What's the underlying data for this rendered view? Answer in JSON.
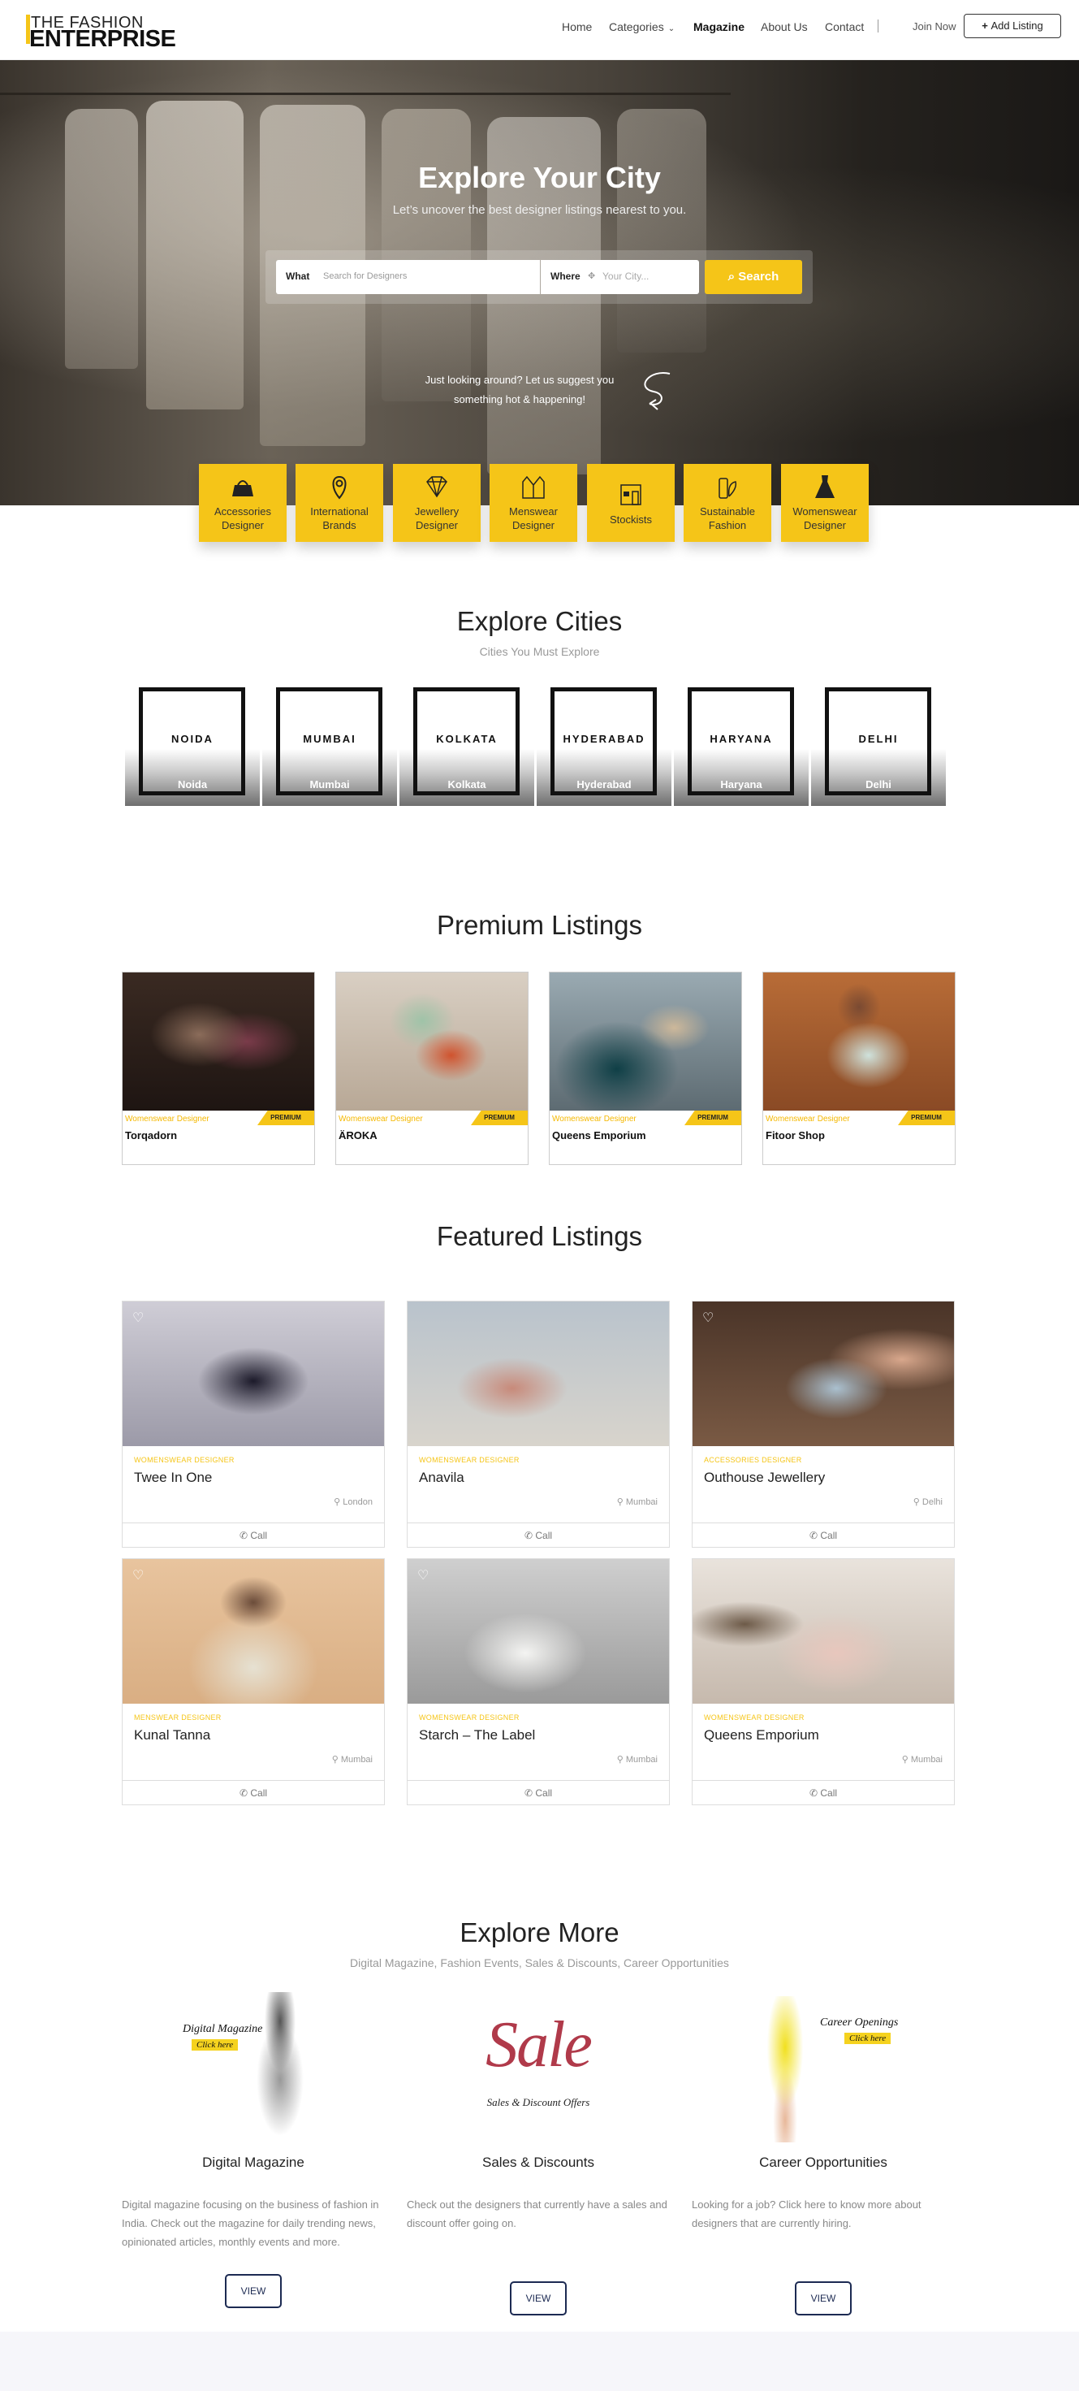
{
  "brand": {
    "line1": "THE FASHION",
    "line2": "ENTERPRISE"
  },
  "nav": {
    "items": [
      "Home",
      "Categories",
      "Magazine",
      "About Us",
      "Contact"
    ],
    "categories_chevron": "chevron-down-icon",
    "join_now": "Join Now",
    "add_listing": "Add Listing",
    "add_listing_icon": "plus-icon"
  },
  "hero": {
    "title": "Explore Your City",
    "subtitle": "Let’s uncover the best designer listings nearest to you.",
    "what_label": "What",
    "what_placeholder": "Search for Designers",
    "where_label": "Where",
    "where_placeholder": "Your City...",
    "search_button": "Search",
    "suggest_line1": "Just looking around? Let us suggest you",
    "suggest_line2": "something hot & happening!"
  },
  "categories": [
    {
      "label_1": "Accessories",
      "label_2": "Designer",
      "icon": "handbag-icon"
    },
    {
      "label_1": "International",
      "label_2": "Brands",
      "icon": "map-pin-icon"
    },
    {
      "label_1": "Jewellery",
      "label_2": "Designer",
      "icon": "diamond-icon"
    },
    {
      "label_1": "Menswear",
      "label_2": "Designer",
      "icon": "jacket-icon"
    },
    {
      "label_1": "Stockists",
      "label_2": "",
      "icon": "store-icon"
    },
    {
      "label_1": "Sustainable",
      "label_2": "Fashion",
      "icon": "eco-bottle-icon"
    },
    {
      "label_1": "Womenswear",
      "label_2": "Designer",
      "icon": "dress-icon"
    }
  ],
  "cities_section": {
    "title": "Explore Cities",
    "subtitle": "Cities You Must Explore",
    "cities": [
      {
        "tile": "NOIDA",
        "caption": "Noida"
      },
      {
        "tile": "MUMBAI",
        "caption": "Mumbai"
      },
      {
        "tile": "KOLKATA",
        "caption": "Kolkata"
      },
      {
        "tile": "HYDERABAD",
        "caption": "Hyderabad"
      },
      {
        "tile": "HARYANA",
        "caption": "Haryana"
      },
      {
        "tile": "DELHI",
        "caption": "Delhi"
      }
    ]
  },
  "premium": {
    "title": "Premium Listings",
    "badge": "PREMIUM",
    "items": [
      {
        "category": "Womenswear Designer",
        "name": "Torqadorn"
      },
      {
        "category": "Womenswear Designer",
        "name": "ÄROKA"
      },
      {
        "category": "Womenswear Designer",
        "name": "Queens Emporium"
      },
      {
        "category": "Womenswear Designer",
        "name": "Fitoor Shop"
      }
    ]
  },
  "featured": {
    "title": "Featured Listings",
    "call_label": "Call",
    "items": [
      {
        "category": "WOMENSWEAR DESIGNER",
        "name": "Twee In One",
        "location": "London"
      },
      {
        "category": "WOMENSWEAR DESIGNER",
        "name": "Anavila",
        "location": "Mumbai"
      },
      {
        "category": "ACCESSORIES DESIGNER",
        "name": "Outhouse Jewellery",
        "location": "Delhi"
      },
      {
        "category": "MENSWEAR DESIGNER",
        "name": "Kunal Tanna",
        "location": "Mumbai"
      },
      {
        "category": "WOMENSWEAR DESIGNER",
        "name": "Starch – The Label",
        "location": "Mumbai"
      },
      {
        "category": "WOMENSWEAR DESIGNER",
        "name": "Queens Emporium",
        "location": "Mumbai"
      }
    ]
  },
  "explore_more": {
    "title": "Explore More",
    "subtitle": "Digital Magazine, Fashion Events, Sales & Discounts, Career Opportunities",
    "view_label": "VIEW",
    "items": [
      {
        "title": "Digital Magazine",
        "art_text": "Digital Magazine",
        "art_button": "Click here",
        "desc": "Digital magazine focusing on the business of fashion in India. Check out the magazine for daily trending news, opinionated articles, monthly events and more."
      },
      {
        "title": "Sales & Discounts",
        "art_text": "Sale",
        "art_sub": "Sales & Discount Offers",
        "desc": "Check out the designers that currently have a sales and discount offer going on."
      },
      {
        "title": "Career Opportunities",
        "art_text": "Career Openings",
        "art_button": "Click here",
        "desc": "Looking for a job? Click here to know more about designers that are currently hiring."
      }
    ]
  },
  "colors": {
    "accent": "#f5c518",
    "dark_navy": "#1c2a52"
  }
}
